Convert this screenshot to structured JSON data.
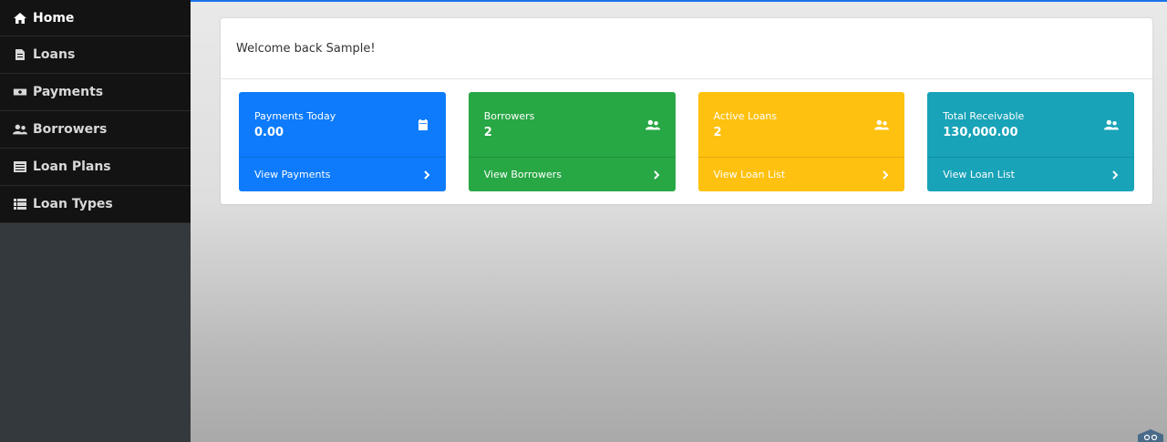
{
  "sidebar": {
    "items": [
      {
        "label": "Home",
        "icon": "home-icon"
      },
      {
        "label": "Loans",
        "icon": "file-icon"
      },
      {
        "label": "Payments",
        "icon": "money-icon"
      },
      {
        "label": "Borrowers",
        "icon": "users-icon"
      },
      {
        "label": "Loan Plans",
        "icon": "list-icon"
      },
      {
        "label": "Loan Types",
        "icon": "table-icon"
      }
    ]
  },
  "welcome": "Welcome back Sample!",
  "tiles": [
    {
      "label": "Payments Today",
      "value": "0.00",
      "link": "View Payments",
      "icon": "calendar-icon",
      "color": "#0d7bfb"
    },
    {
      "label": "Borrowers",
      "value": "2",
      "link": "View Borrowers",
      "icon": "users-icon",
      "color": "#28a745"
    },
    {
      "label": "Active Loans",
      "value": "2",
      "link": "View Loan List",
      "icon": "users-icon",
      "color": "#ffc10f"
    },
    {
      "label": "Total Receivable",
      "value": "130,000.00",
      "link": "View Loan List",
      "icon": "users-icon",
      "color": "#18a3b8"
    }
  ]
}
